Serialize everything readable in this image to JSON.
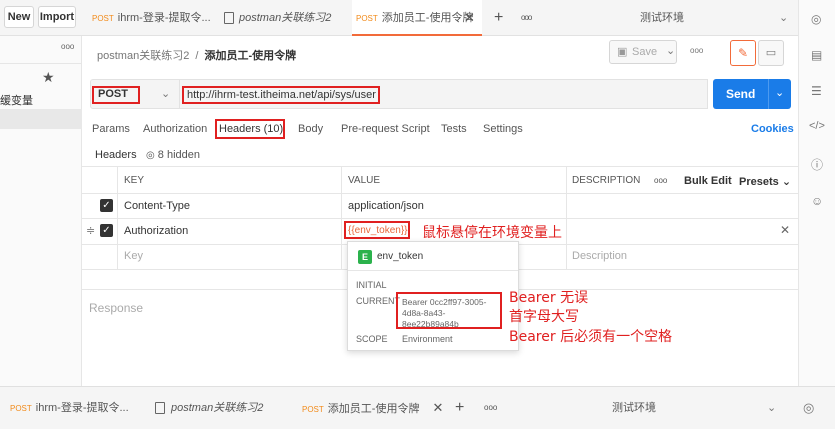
{
  "topbar": {
    "new_label": "New",
    "import_label": "Import",
    "tabs": [
      {
        "method": "POST",
        "label": "ihrm-登录-提取令..."
      },
      {
        "method": "",
        "label": "postman关联练习2"
      },
      {
        "method": "POST",
        "label": "添加员工-使用令牌"
      }
    ],
    "add_tab": "+",
    "more": "ooo",
    "environment": "测试环境"
  },
  "sidebar": {
    "more": "ooo",
    "item_label": "缓变量"
  },
  "breadcrumb": {
    "collection": "postman关联练习2",
    "separator": "/",
    "request": "添加员工-使用令牌"
  },
  "toolbar": {
    "save_label": "Save",
    "more": "ooo"
  },
  "request": {
    "method": "POST",
    "url": "http://ihrm-test.itheima.net/api/sys/user",
    "send_label": "Send"
  },
  "request_tabs": {
    "params": "Params",
    "authorization": "Authorization",
    "headers": "Headers (10)",
    "body": "Body",
    "prerequest": "Pre-request Script",
    "tests": "Tests",
    "settings": "Settings",
    "cookies": "Cookies"
  },
  "headers_section": {
    "title": "Headers",
    "hidden": "8 hidden"
  },
  "table": {
    "col_key": "KEY",
    "col_value": "VALUE",
    "col_description": "DESCRIPTION",
    "more": "ooo",
    "bulk_edit": "Bulk Edit",
    "presets": "Presets",
    "rows": [
      {
        "key": "Content-Type",
        "value": "application/json"
      },
      {
        "key": "Authorization",
        "value": "{{env_token}}"
      }
    ],
    "placeholder_key": "Key",
    "placeholder_description": "Description"
  },
  "popup": {
    "badge": "E",
    "var_name": "env_token",
    "initial_label": "INITIAL",
    "current_label": "CURRENT",
    "current_value_1": "Bearer 0cc2ff97-3005-",
    "current_value_2": "4d8a-8a43-",
    "current_value_3": "8ee22b89a84b",
    "scope_label": "SCOPE",
    "scope_value": "Environment"
  },
  "response": {
    "label": "Response"
  },
  "annotations": {
    "hover_note": "鼠标悬停在环境变量上",
    "note1": "Bearer 无误",
    "note2": "首字母大写",
    "note3": "Bearer 后必须有一个空格"
  },
  "bottombar": {
    "tabs": [
      {
        "method": "POST",
        "label": "ihrm-登录-提取令..."
      },
      {
        "method": "",
        "label": "postman关联练习2"
      },
      {
        "method": "POST",
        "label": "添加员工-使用令牌"
      }
    ],
    "add_tab": "+",
    "more": "ooo",
    "environment": "测试环境"
  },
  "colors": {
    "accent_orange": "#f26b3a",
    "send_blue": "#1a7ce8",
    "annotation_red": "#e02020",
    "env_green": "#2bb24c"
  }
}
